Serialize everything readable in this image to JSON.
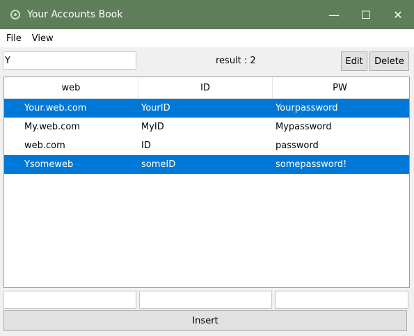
{
  "window": {
    "title": "Your Accounts Book",
    "minimize_glyph": "—",
    "maximize_glyph": "☐",
    "close_glyph": "✕"
  },
  "menu": {
    "file": "File",
    "view": "View"
  },
  "toolbar": {
    "search_value": "Y",
    "result_label": "result : 2",
    "edit_label": "Edit",
    "delete_label": "Delete"
  },
  "table": {
    "headers": [
      "web",
      "ID",
      "PW"
    ],
    "rows": [
      {
        "web": "Your.web.com",
        "id": "YourID",
        "pw": "Yourpassword",
        "selected": true
      },
      {
        "web": "My.web.com",
        "id": "MyID",
        "pw": "Mypassword",
        "selected": false
      },
      {
        "web": "web.com",
        "id": "ID",
        "pw": "password",
        "selected": false
      },
      {
        "web": "Ysomeweb",
        "id": "someID",
        "pw": "somepassword!",
        "selected": true
      }
    ]
  },
  "footer": {
    "insert_label": "Insert"
  },
  "colors": {
    "titlebar": "#5e7d59",
    "selection": "#0078d7"
  },
  "icons": {
    "app": "leaf-icon"
  }
}
